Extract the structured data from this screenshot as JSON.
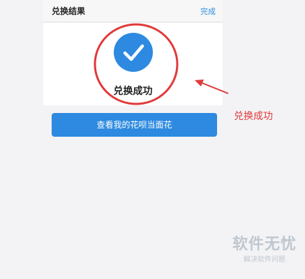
{
  "header": {
    "title": "兑换结果",
    "done_label": "完成"
  },
  "result": {
    "status_text": "兑换成功"
  },
  "actions": {
    "view_huabei_label": "查看我的花呗当面花"
  },
  "annotation": {
    "label": "兑换成功"
  },
  "watermark": {
    "main": "软件无忧",
    "sub": "解决软件问题"
  },
  "colors": {
    "accent": "#2d8ae0",
    "annotation": "#e03a3a"
  }
}
